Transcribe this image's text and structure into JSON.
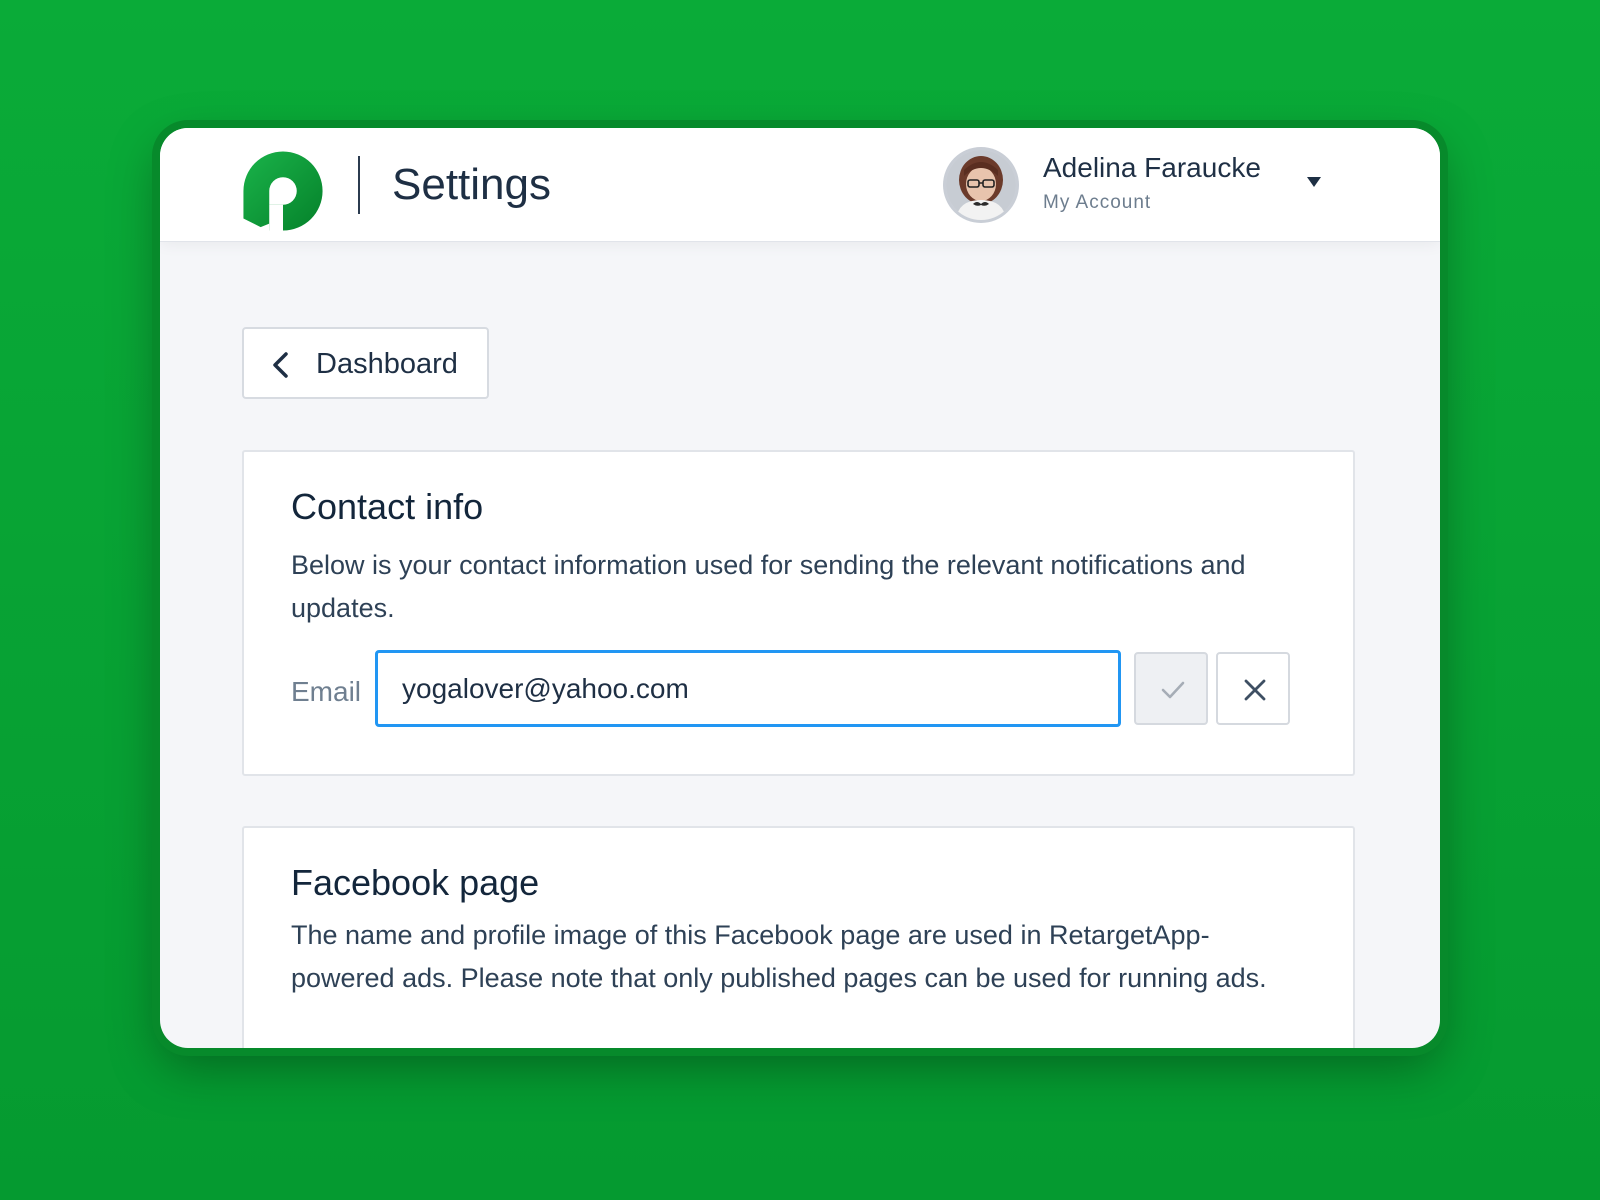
{
  "header": {
    "title": "Settings",
    "logo_icon": "retargetapp-logo-icon",
    "brand_color": "#0aab38"
  },
  "account": {
    "name": "Adelina Faraucke",
    "subtitle": "My Account",
    "dropdown_icon": "caret-down-icon"
  },
  "nav": {
    "back_label": "Dashboard",
    "back_icon": "chevron-left-icon"
  },
  "contact": {
    "title": "Contact info",
    "description": "Below is your contact information used for sending the relevant notifications and updates.",
    "email_label": "Email",
    "email_value": "yogalover@yahoo.com",
    "confirm_icon": "check-icon",
    "cancel_icon": "close-icon",
    "focus_color": "#2196f3"
  },
  "facebook": {
    "title": "Facebook page",
    "description": "The name and profile image of this Facebook page are used in RetargetApp-powered ads. Please note that only published pages can be used for running ads."
  }
}
